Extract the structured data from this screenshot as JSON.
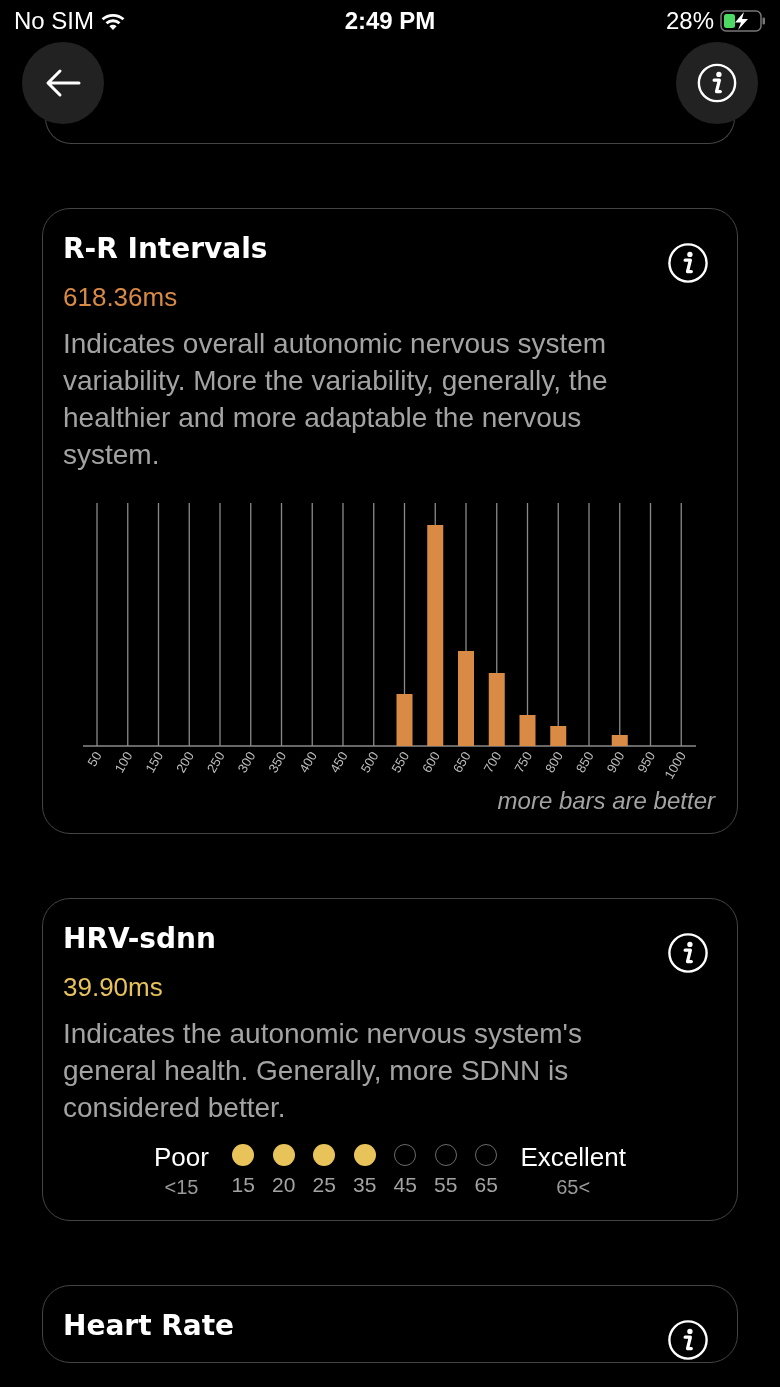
{
  "status_bar": {
    "carrier": "No SIM",
    "time": "2:49 PM",
    "battery": "28%"
  },
  "cards": [
    {
      "kind": "histogram",
      "title": "R-R Intervals",
      "value": "618.36ms",
      "color": "#d98a45",
      "description": "Indicates overall autonomic nervous system variability. More the variability, generally, the healthier and more adaptable the nervous system.",
      "axis_labels": [
        "50",
        "100",
        "150",
        "200",
        "250",
        "300",
        "350",
        "400",
        "450",
        "500",
        "550",
        "600",
        "650",
        "700",
        "750",
        "800",
        "850",
        "900",
        "950",
        "1000"
      ],
      "caption": "more bars are better"
    },
    {
      "kind": "rating",
      "title": "HRV-sdnn",
      "value": "39.90ms",
      "color": "#e8c35a",
      "description": "Indicates the autonomic nervous system's general health. Generally, more SDNN is considered better.",
      "scale": {
        "low_label": "Poor",
        "low_value": "<15",
        "high_label": "Excellent",
        "high_value": "65<",
        "points": [
          {
            "label": "15",
            "filled": true
          },
          {
            "label": "20",
            "filled": true
          },
          {
            "label": "25",
            "filled": true
          },
          {
            "label": "35",
            "filled": true
          },
          {
            "label": "45",
            "filled": false
          },
          {
            "label": "55",
            "filled": false
          },
          {
            "label": "65",
            "filled": false
          }
        ]
      }
    },
    {
      "kind": "header",
      "title": "Heart Rate"
    }
  ]
}
